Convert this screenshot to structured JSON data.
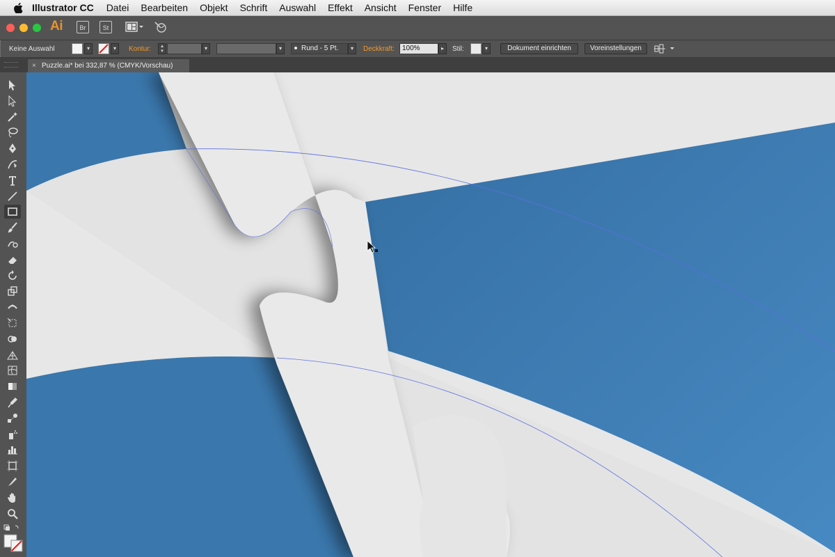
{
  "menubar": {
    "app_name": "Illustrator CC",
    "items": [
      "Datei",
      "Bearbeiten",
      "Objekt",
      "Schrift",
      "Auswahl",
      "Effekt",
      "Ansicht",
      "Fenster",
      "Hilfe"
    ]
  },
  "appbar": {
    "logo": "Ai",
    "bridge_label": "Br",
    "stock_label": "St"
  },
  "controlbar": {
    "selection_status": "Keine Auswahl",
    "kontur_label": "Kontur:",
    "brush_label": "Rund - 5 Pt.",
    "deckkraft_label": "Deckkraft:",
    "deckkraft_value": "100%",
    "stil_label": "Stil:",
    "document_setup_button": "Dokument einrichten",
    "preferences_button": "Voreinstellungen"
  },
  "tab": {
    "title": "Puzzle.ai* bei 332,87 % (CMYK/Vorschau)",
    "close": "×"
  },
  "tools": [
    "selection-tool",
    "direct-selection-tool",
    "magic-wand-tool",
    "lasso-tool",
    "pen-tool",
    "curvature-tool",
    "type-tool",
    "line-segment-tool",
    "rectangle-tool",
    "paintbrush-tool",
    "shaper-tool",
    "eraser-tool",
    "rotate-tool",
    "scale-tool",
    "width-tool",
    "free-transform-tool",
    "shape-builder-tool",
    "perspective-grid-tool",
    "mesh-tool",
    "gradient-tool",
    "eyedropper-tool",
    "blend-tool",
    "symbol-sprayer-tool",
    "column-graph-tool",
    "artboard-tool",
    "slice-tool",
    "hand-tool",
    "zoom-tool"
  ],
  "colors": {
    "puzzle_blue": "#3a77ac",
    "puzzle_gray": "#dcdcdc",
    "background": "#e7e7e7",
    "guide_line": "#5b6fe0",
    "accent_orange": "#f39a2b"
  }
}
